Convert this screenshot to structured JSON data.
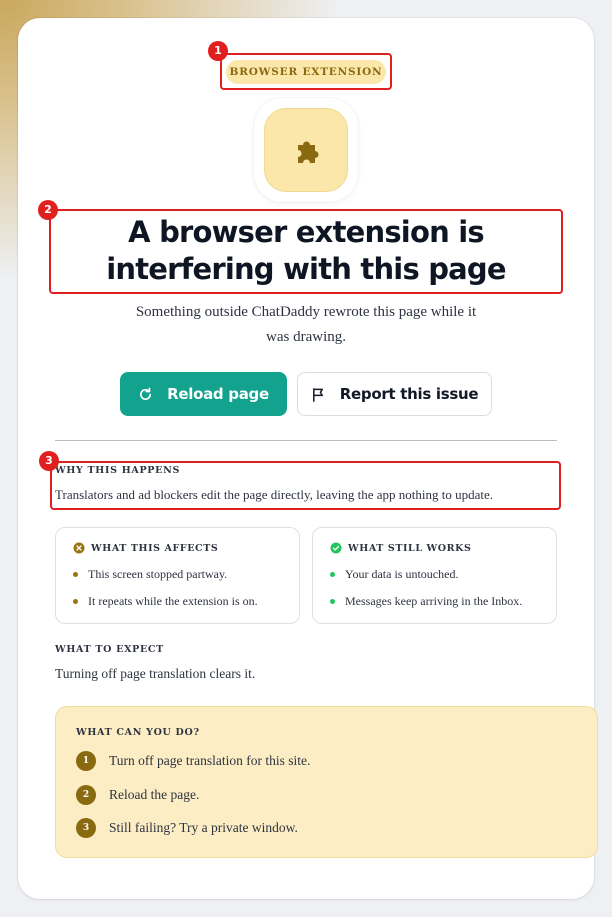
{
  "badge": "BROWSER EXTENSION",
  "title": "A browser extension is interfering with this page",
  "subtitle": "Something outside ChatDaddy rewrote this page while it was drawing.",
  "buttons": {
    "reload": {
      "label": "Reload page",
      "icon": "refresh-icon"
    },
    "report": {
      "label": "Report this issue",
      "icon": "flag-icon"
    }
  },
  "why": {
    "label": "WHY THIS HAPPENS",
    "text": "Translators and ad blockers edit the page directly, leaving the app nothing to update."
  },
  "affects": {
    "title": "WHAT THIS AFFECTS",
    "icon": "x-circle-icon",
    "items": [
      "This screen stopped partway.",
      "It repeats while the extension is on."
    ]
  },
  "works": {
    "title": "WHAT STILL WORKS",
    "icon": "check-circle-icon",
    "items": [
      "Your data is untouched.",
      "Messages keep arriving in the Inbox."
    ]
  },
  "expect": {
    "label": "WHAT TO EXPECT",
    "text": "Turning off page translation clears it."
  },
  "actions": {
    "label": "WHAT CAN YOU DO?",
    "steps": [
      {
        "num": "1",
        "text": "Turn off page translation for this site."
      },
      {
        "num": "2",
        "text": "Reload the page."
      },
      {
        "num": "3",
        "text": "Still failing? Try a private window."
      }
    ]
  },
  "annotations": [
    "1",
    "2",
    "3"
  ],
  "colors": {
    "accent": "#12a28d",
    "badge_bg": "#fbe7a9",
    "badge_text": "#8a6a10",
    "negative": "#9a7412",
    "positive": "#22c55e",
    "callout": "#e0201e"
  }
}
